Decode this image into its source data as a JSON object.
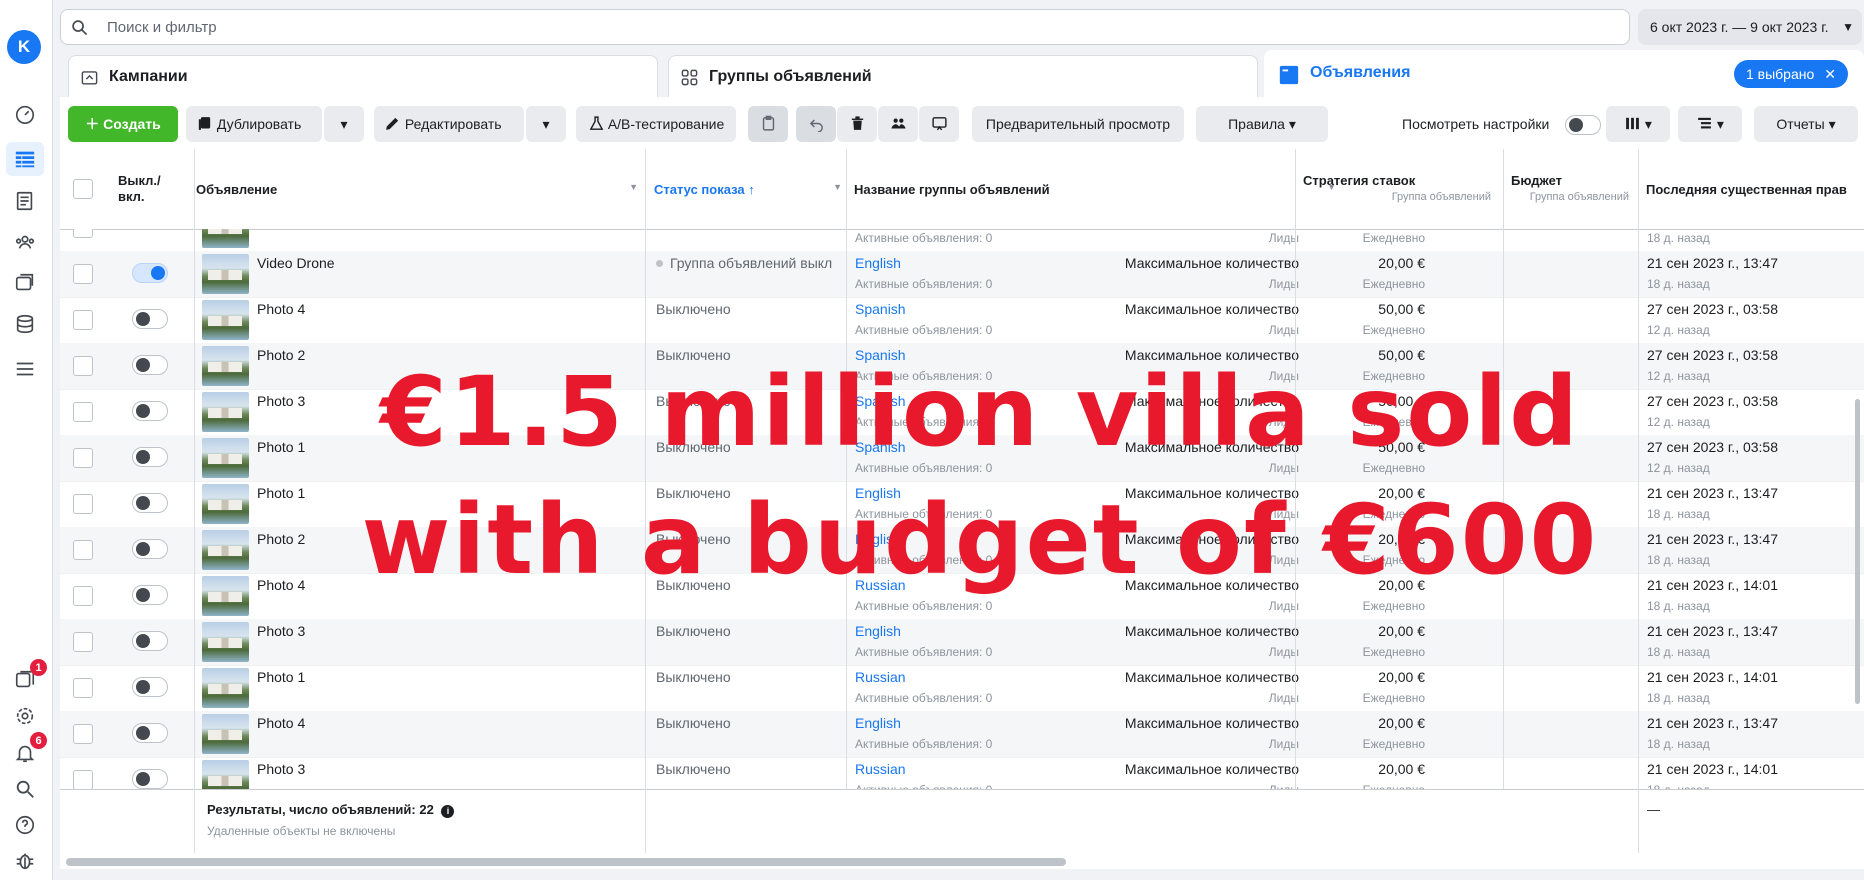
{
  "search": {
    "placeholder": "Поиск и фильтр"
  },
  "date_range": "6 окт 2023 г. — 9 окт 2023 г.",
  "rail": {
    "avatar": "K",
    "inbox_badge": "1",
    "notif_badge": "6"
  },
  "level_tabs": {
    "campaigns": "Кампании",
    "adsets": "Группы объявлений",
    "ads": "Объявления",
    "selected_chip": "1 выбрано"
  },
  "toolbar": {
    "create": "Создать",
    "duplicate": "Дублировать",
    "edit": "Редактировать",
    "ab_test": "A/B-тестирование",
    "preview": "Предварительный просмотр",
    "rules": "Правила",
    "view_settings": "Посмотреть настройки",
    "reports": "Отчеты"
  },
  "table": {
    "headers": {
      "toggle": "Выкл./\nвкл.",
      "ad": "Объявление",
      "status": "Статус показа",
      "adset_name": "Название группы объявлений",
      "bid_strategy": "Стратегия ставок",
      "bid_strategy_sub": "Группа объявлений",
      "budget": "Бюджет",
      "budget_sub": "Группа объявлений",
      "last_edit": "Последняя существенная прав"
    },
    "partial_row": {
      "adset_sub": "Активные объявления: 0",
      "bid_sub": "Лиды",
      "budget_sub": "Ежедневно",
      "edit_sub": "18 д. назад"
    },
    "rows": [
      {
        "name": "Video Drone",
        "on": true,
        "status": "Группа объявлений выкл",
        "adset": "English",
        "adset_sub": "Активные объявления: 0",
        "bid": "Максимальное количество",
        "bid_sub": "Лиды",
        "budget": "20,00 €",
        "budget_sub": "Ежедневно",
        "edited": "21 сен 2023 г., 13:47",
        "edited_sub": "18 д. назад"
      },
      {
        "name": "Photo 4",
        "on": false,
        "status": "Выключено",
        "adset": "Spanish",
        "adset_sub": "Активные объявления: 0",
        "bid": "Максимальное количество",
        "bid_sub": "Лиды",
        "budget": "50,00 €",
        "budget_sub": "Ежедневно",
        "edited": "27 сен 2023 г., 03:58",
        "edited_sub": "12 д. назад"
      },
      {
        "name": "Photo 2",
        "on": false,
        "status": "Выключено",
        "adset": "Spanish",
        "adset_sub": "Активные объявления: 0",
        "bid": "Максимальное количество",
        "bid_sub": "Лиды",
        "budget": "50,00 €",
        "budget_sub": "Ежедневно",
        "edited": "27 сен 2023 г., 03:58",
        "edited_sub": "12 д. назад"
      },
      {
        "name": "Photo 3",
        "on": false,
        "status": "Выключено",
        "adset": "Spanish",
        "adset_sub": "Активные объявления: 0",
        "bid": "Максимальное количество",
        "bid_sub": "Лиды",
        "budget": "50,00 €",
        "budget_sub": "Ежедневно",
        "edited": "27 сен 2023 г., 03:58",
        "edited_sub": "12 д. назад"
      },
      {
        "name": "Photo 1",
        "on": false,
        "status": "Выключено",
        "adset": "Spanish",
        "adset_sub": "Активные объявления: 0",
        "bid": "Максимальное количество",
        "bid_sub": "Лиды",
        "budget": "50,00 €",
        "budget_sub": "Ежедневно",
        "edited": "27 сен 2023 г., 03:58",
        "edited_sub": "12 д. назад"
      },
      {
        "name": "Photo 1",
        "on": false,
        "status": "Выключено",
        "adset": "English",
        "adset_sub": "Активные объявления: 0",
        "bid": "Максимальное количество",
        "bid_sub": "Лиды",
        "budget": "20,00 €",
        "budget_sub": "Ежедневно",
        "edited": "21 сен 2023 г., 13:47",
        "edited_sub": "18 д. назад"
      },
      {
        "name": "Photo 2",
        "on": false,
        "status": "Выключено",
        "adset": "English",
        "adset_sub": "Активные объявления: 0",
        "bid": "Максимальное количество",
        "bid_sub": "Лиды",
        "budget": "20,00 €",
        "budget_sub": "Ежедневно",
        "edited": "21 сен 2023 г., 13:47",
        "edited_sub": "18 д. назад"
      },
      {
        "name": "Photo 4",
        "on": false,
        "status": "Выключено",
        "adset": "Russian",
        "adset_sub": "Активные объявления: 0",
        "bid": "Максимальное количество",
        "bid_sub": "Лиды",
        "budget": "20,00 €",
        "budget_sub": "Ежедневно",
        "edited": "21 сен 2023 г., 14:01",
        "edited_sub": "18 д. назад"
      },
      {
        "name": "Photo 3",
        "on": false,
        "status": "Выключено",
        "adset": "English",
        "adset_sub": "Активные объявления: 0",
        "bid": "Максимальное количество",
        "bid_sub": "Лиды",
        "budget": "20,00 €",
        "budget_sub": "Ежедневно",
        "edited": "21 сен 2023 г., 13:47",
        "edited_sub": "18 д. назад"
      },
      {
        "name": "Photo 1",
        "on": false,
        "status": "Выключено",
        "adset": "Russian",
        "adset_sub": "Активные объявления: 0",
        "bid": "Максимальное количество",
        "bid_sub": "Лиды",
        "budget": "20,00 €",
        "budget_sub": "Ежедневно",
        "edited": "21 сен 2023 г., 14:01",
        "edited_sub": "18 д. назад"
      },
      {
        "name": "Photo 4",
        "on": false,
        "status": "Выключено",
        "adset": "English",
        "adset_sub": "Активные объявления: 0",
        "bid": "Максимальное количество",
        "bid_sub": "Лиды",
        "budget": "20,00 €",
        "budget_sub": "Ежедневно",
        "edited": "21 сен 2023 г., 13:47",
        "edited_sub": "18 д. назад"
      },
      {
        "name": "Photo 3",
        "on": false,
        "status": "Выключено",
        "adset": "Russian",
        "adset_sub": "Активные объявления: 0",
        "bid": "Максимальное количество",
        "bid_sub": "Лиды",
        "budget": "20,00 €",
        "budget_sub": "Ежедневно",
        "edited": "21 сен 2023 г., 14:01",
        "edited_sub": "18 д. назад"
      }
    ],
    "summary": {
      "results": "Результаты, число объявлений: 22",
      "note": "Удаленные объекты не включены",
      "last_col": "—"
    }
  },
  "overlay": {
    "line1": "€1.5 million villa sold",
    "line2": "with a budget of €600"
  },
  "colors": {
    "accent": "#1877f2",
    "create": "#42b72a",
    "overlay": "#e8192c",
    "badge": "#e41e3f"
  }
}
